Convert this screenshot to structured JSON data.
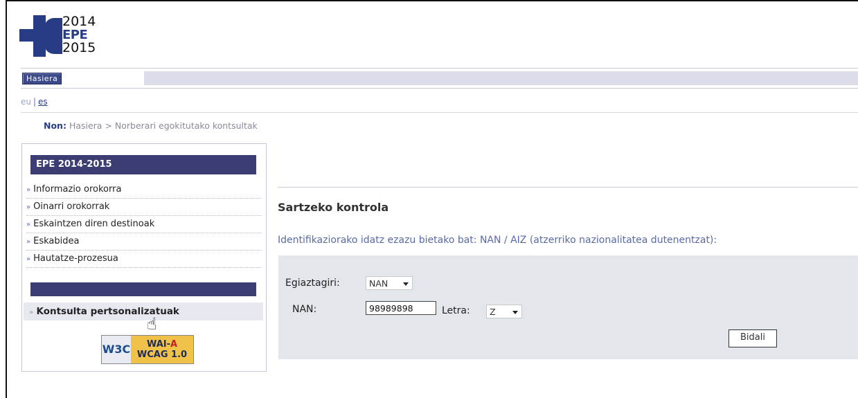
{
  "logo": {
    "line1": "2014",
    "line2": "EPE",
    "line3": "2015"
  },
  "topnav": {
    "home_button": "Hasiera"
  },
  "lang": {
    "eu": "eu",
    "sep": "|",
    "es": "es"
  },
  "breadcrumb": {
    "label": "Non:",
    "path": "Hasiera > Norberari egokitutako kontsultak"
  },
  "sidebar": {
    "heading": "EPE 2014-2015",
    "items": [
      {
        "label": "Informazio orokorra"
      },
      {
        "label": "Oinarri orokorrak"
      },
      {
        "label": "Eskaintzen diren destinoak"
      },
      {
        "label": "Eskabidea"
      },
      {
        "label": "Hautatze-prozesua"
      }
    ],
    "selected_item": "Kontsulta pertsonalizatuak",
    "badge": {
      "left": "W3C",
      "top": "WAI-",
      "top_red": "A",
      "bottom": "WCAG 1.0"
    }
  },
  "main": {
    "title": "Sartzeko kontrola",
    "info": "Identifikaziorako idatz ezazu bietako bat: NAN / AIZ (atzerriko nazionalitatea dutenentzat):",
    "form": {
      "doc_label": "Egiaztagiri:",
      "doc_value": "NAN",
      "nan_label": "NAN:",
      "nan_value": "98989898",
      "letter_label": "Letra:",
      "letter_value": "Z",
      "submit_label": "Bidali"
    }
  },
  "colors": {
    "accent": "#3c3d73",
    "link": "#283c86",
    "form_bg": "#e3e6ea"
  }
}
